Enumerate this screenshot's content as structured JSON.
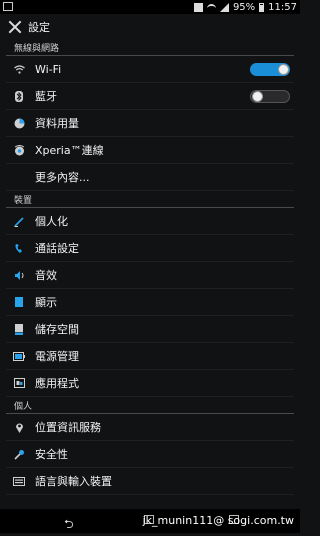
{
  "status_bar": {
    "battery": "95%",
    "time": "11:57"
  },
  "action_bar": {
    "title": "設定",
    "icon": "wrench-screwdriver-icon"
  },
  "sections": [
    {
      "header": "無線與網路",
      "items": [
        {
          "label": "Wi-Fi",
          "icon": "wifi-icon",
          "toggle": "on"
        },
        {
          "label": "藍牙",
          "icon": "bluetooth-icon",
          "toggle": "off"
        },
        {
          "label": "資料用量",
          "icon": "data-usage-icon"
        },
        {
          "label": "Xperia™連線",
          "icon": "xperia-connect-icon"
        },
        {
          "label": "更多內容...",
          "icon": ""
        }
      ]
    },
    {
      "header": "裝置",
      "items": [
        {
          "label": "個人化",
          "icon": "personalize-icon"
        },
        {
          "label": "通話設定",
          "icon": "phone-icon"
        },
        {
          "label": "音效",
          "icon": "sound-icon"
        },
        {
          "label": "顯示",
          "icon": "display-icon"
        },
        {
          "label": "儲存空間",
          "icon": "storage-icon"
        },
        {
          "label": "電源管理",
          "icon": "battery-icon"
        },
        {
          "label": "應用程式",
          "icon": "apps-icon"
        }
      ]
    },
    {
      "header": "個人",
      "items": [
        {
          "label": "位置資訊服務",
          "icon": "location-icon"
        },
        {
          "label": "安全性",
          "icon": "security-icon"
        },
        {
          "label": "語言與輸入裝置",
          "icon": "keyboard-icon"
        }
      ]
    }
  ],
  "watermark": "jk_munin111@ sogi.com.tw"
}
